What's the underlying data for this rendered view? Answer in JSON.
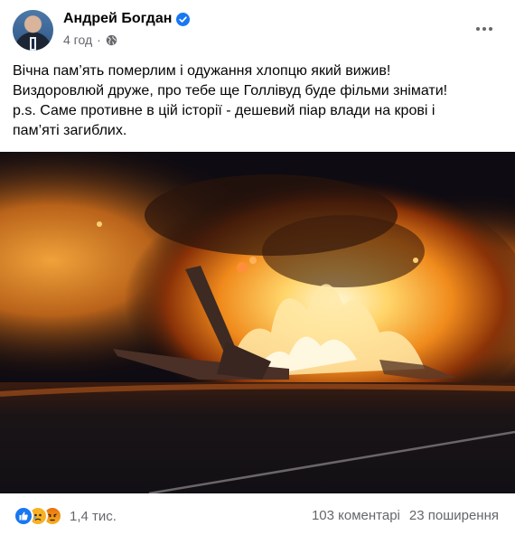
{
  "post": {
    "author": "Андрей Богдан",
    "time": "4 год",
    "separator": "·",
    "text_lines": [
      "Вічна пам’ять померлим і одужання хлопцю який вижив!",
      "Виздоровлюй друже, про тебе ще Голлівуд буде фільми знімати!",
      "p.s. Саме противне в цій історії - дешевий піар влади на крові і",
      "пам’яті загиблих."
    ]
  },
  "icons": {
    "verified": "verified-badge-icon",
    "privacy": "globe-icon",
    "more": "more-options-icon",
    "reactions": [
      "like-reaction-icon",
      "sad-reaction-icon",
      "angry-reaction-icon"
    ]
  },
  "colors": {
    "accent": "#1877f2",
    "secondary_text": "#65676b",
    "text": "#050505",
    "sad": "#f7b125",
    "angry": "#e9710f"
  },
  "footer": {
    "reaction_count": "1,4 тис.",
    "comments": "103 коментарі",
    "shares": "23 поширення"
  }
}
